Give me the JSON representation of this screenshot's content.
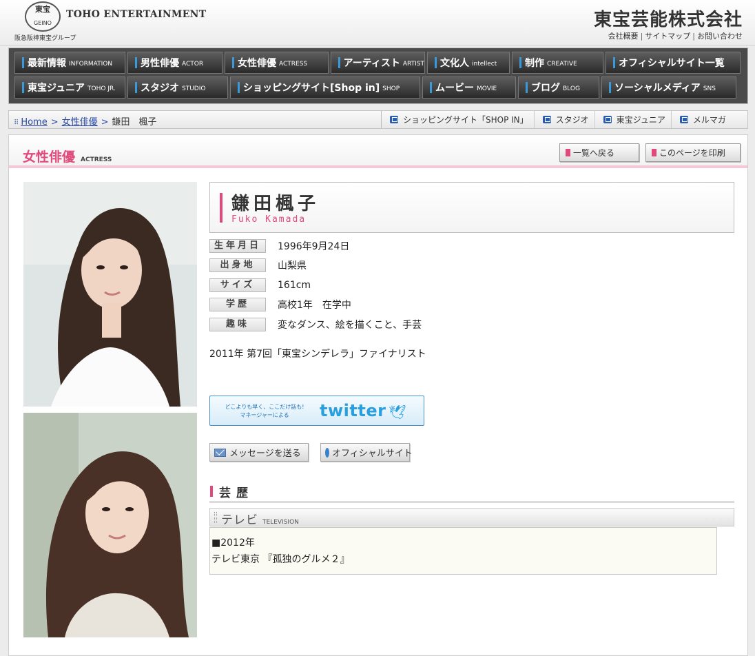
{
  "header": {
    "logo_kanji": "東宝",
    "logo_sub": "GEINO",
    "logo_en": "TOHO ENTERTAINMENT",
    "group": "阪急阪神東宝グループ",
    "company": "東宝芸能株式会社",
    "links": [
      "会社概要",
      "サイトマップ",
      "お問い合わせ"
    ]
  },
  "nav": {
    "row1": [
      {
        "label": "最新情報",
        "sub": "INFORMATION"
      },
      {
        "label": "男性俳優",
        "sub": "ACTOR"
      },
      {
        "label": "女性俳優",
        "sub": "ACTRESS"
      },
      {
        "label": "アーティスト",
        "sub": "ARTIST"
      },
      {
        "label": "文化人",
        "sub": "intellect"
      },
      {
        "label": "制作",
        "sub": "CREATIVE"
      },
      {
        "label": "オフィシャルサイト一覧",
        "sub": ""
      }
    ],
    "row2": [
      {
        "label": "東宝ジュニア",
        "sub": "TOHO JR."
      },
      {
        "label": "スタジオ",
        "sub": "STUDIO"
      },
      {
        "label": "ショッピングサイト[Shop in]",
        "sub": "SHOP"
      },
      {
        "label": "ムービー",
        "sub": "MOVIE"
      },
      {
        "label": "ブログ",
        "sub": "BLOG"
      },
      {
        "label": "ソーシャルメディア",
        "sub": "SNS"
      }
    ]
  },
  "breadcrumb": {
    "home": "Home",
    "category": "女性俳優",
    "current": "鎌田　楓子"
  },
  "quicklinks": [
    "ショッピングサイト「SHOP IN」",
    "スタジオ",
    "東宝ジュニア",
    "メルマガ"
  ],
  "section": {
    "title": "女性俳優",
    "sub": "ACTRESS",
    "back_button": "一覧へ戻る",
    "print_button": "このページを印刷"
  },
  "profile": {
    "name_ja": "鎌田楓子",
    "name_en": "Fuko Kamada",
    "rows": [
      {
        "label": "生年月日",
        "value": "1996年9月24日"
      },
      {
        "label": "出身地",
        "value": "山梨県"
      },
      {
        "label": "サイズ",
        "value": "161cm"
      },
      {
        "label": "学歴",
        "value": "高校1年　在学中"
      },
      {
        "label": "趣味",
        "value": "変なダンス、絵を描くこと、手芸"
      }
    ],
    "award": "2011年 第7回「東宝シンデレラ」ファイナリスト"
  },
  "twitter": {
    "lead_line1": "どこよりも早く、ここだけ話も!",
    "lead_line2": "マネージャーによる",
    "wordmark": "twitter"
  },
  "actions": {
    "message": "メッセージを送る",
    "official": "オフィシャルサイト"
  },
  "career": {
    "title": "芸歴",
    "tv_title": "テレビ",
    "tv_sub": "TELEVISION",
    "entries": [
      {
        "year": "■2012年",
        "text": "テレビ東京 『孤独のグルメ２』"
      }
    ]
  },
  "colors": {
    "accent": "#e0497a",
    "nav_bg": "#3a3a3a",
    "link": "#2a4aa8",
    "twitter": "#2a9fe0"
  }
}
